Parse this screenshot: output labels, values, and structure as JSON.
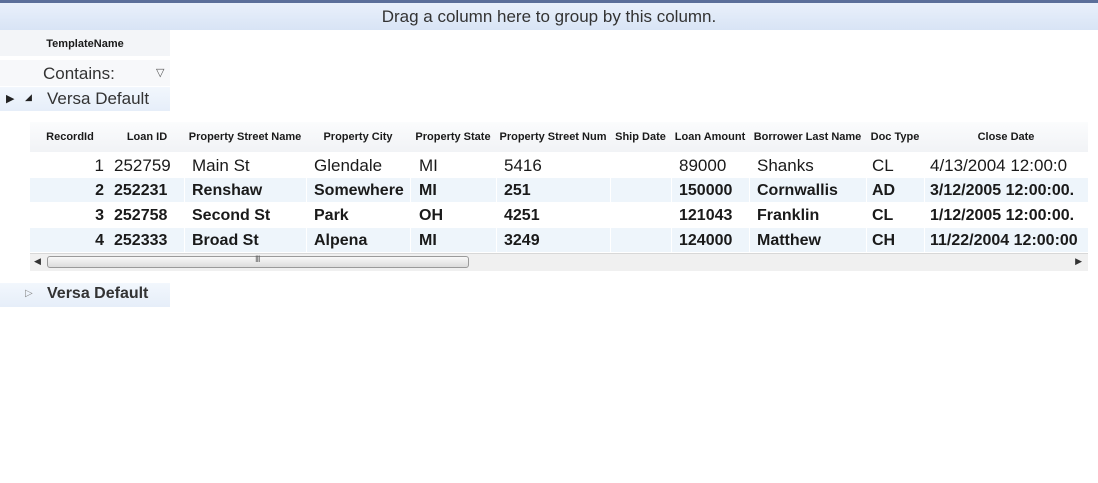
{
  "group_panel": {
    "text": "Drag a column here to group by this column."
  },
  "top_grid": {
    "column_header": "TemplateName",
    "filter": {
      "label": "Contains:",
      "icon": "filter-icon"
    }
  },
  "groups": [
    {
      "label": "Versa Default",
      "expanded": true
    },
    {
      "label": "Versa Default",
      "expanded": false
    }
  ],
  "inner_grid": {
    "columns": [
      "RecordId",
      "Loan ID",
      "Property Street Name",
      "Property City",
      "Property State",
      "Property Street Num",
      "Ship Date",
      "Loan Amount",
      "Borrower Last Name",
      "Doc Type",
      "Close Date"
    ],
    "rows": [
      {
        "record_id": "1",
        "loan_id": "252759",
        "street": "Main St",
        "city": "Glendale",
        "state": "MI",
        "street_num": "5416",
        "ship_date": "",
        "amount": "89000",
        "last_name": "Shanks",
        "doc_type": "CL",
        "close_date": "4/13/2004 12:00:0"
      },
      {
        "record_id": "2",
        "loan_id": "252231",
        "street": "Renshaw",
        "city": "Somewhere",
        "state": "MI",
        "street_num": "251",
        "ship_date": "",
        "amount": "150000",
        "last_name": "Cornwallis",
        "doc_type": "AD",
        "close_date": "3/12/2005 12:00:00."
      },
      {
        "record_id": "3",
        "loan_id": "252758",
        "street": "Second St",
        "city": "Park",
        "state": "OH",
        "street_num": "4251",
        "ship_date": "",
        "amount": "121043",
        "last_name": "Franklin",
        "doc_type": "CL",
        "close_date": "1/12/2005 12:00:00."
      },
      {
        "record_id": "4",
        "loan_id": "252333",
        "street": "Broad St",
        "city": "Alpena",
        "state": "MI",
        "street_num": "3249",
        "ship_date": "",
        "amount": "124000",
        "last_name": "Matthew",
        "doc_type": "CH",
        "close_date": "11/22/2004 12:00:00"
      }
    ]
  },
  "scrollbar": {
    "grip": "III"
  }
}
